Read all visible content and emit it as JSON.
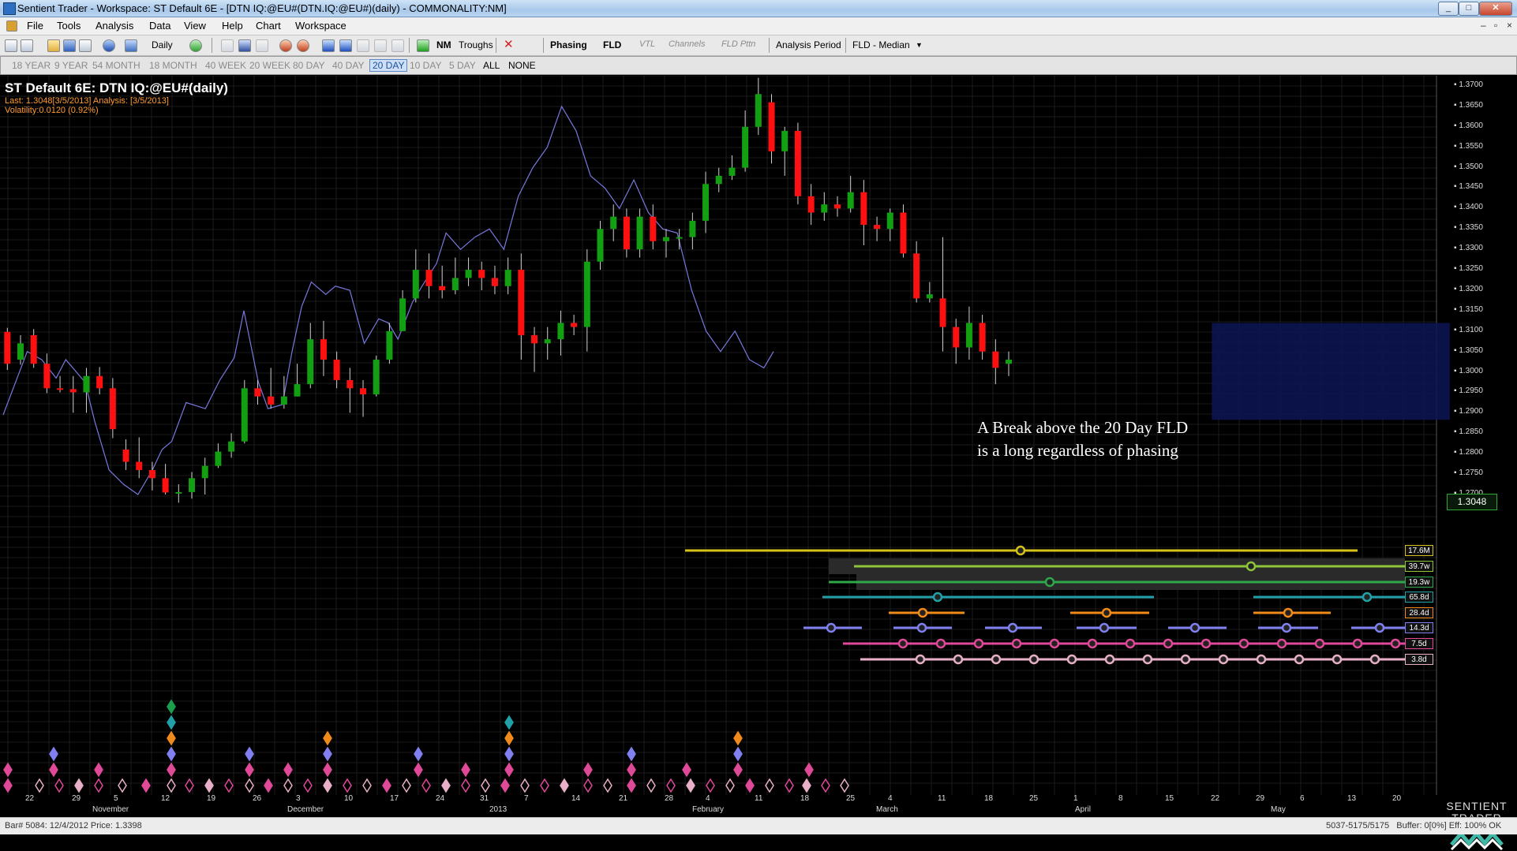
{
  "window": {
    "title": "Sentient Trader - Workspace: ST Default 6E - [DTN IQ:@EU#(DTN.IQ:@EU#)(daily) - COMMONALITY:NM]"
  },
  "menu": [
    "File",
    "Tools",
    "Analysis",
    "Data",
    "View",
    "Help",
    "Chart",
    "Workspace"
  ],
  "toolbar": {
    "interval": "Daily",
    "nm": "NM",
    "troughs": "Troughs",
    "phasing": "Phasing",
    "fld": "FLD",
    "vtl": "VTL",
    "channels": "Channels",
    "fld_pttn": "FLD Pttn",
    "analysis_period": "Analysis Period",
    "fld_median": "FLD - Median"
  },
  "periods": [
    "18 YEAR",
    "9 YEAR",
    "54 MONTH",
    "18 MONTH",
    "40 WEEK",
    "20 WEEK",
    "80 DAY",
    "40 DAY",
    "20 DAY",
    "10 DAY",
    "5 DAY",
    "ALL",
    "NONE"
  ],
  "active_period": "20 DAY",
  "chart": {
    "title": "ST Default 6E: DTN IQ:@EU#(daily)",
    "last_line": "Last: 1.3048[3/5/2013] Analysis: [3/5/2013]",
    "volatility_line": "Volatility:0.0120 (0.92%)",
    "last_price": "1.3048",
    "annotation_line1": "A Break above the 20 Day FLD",
    "annotation_line2": "is a long regardless of phasing",
    "price_ticks": [
      "1.3700",
      "1.3650",
      "1.3600",
      "1.3550",
      "1.3500",
      "1.3450",
      "1.3400",
      "1.3350",
      "1.3300",
      "1.3250",
      "1.3200",
      "1.3150",
      "1.3100",
      "1.3050",
      "1.3000",
      "1.2950",
      "1.2900",
      "1.2850",
      "1.2800",
      "1.2750",
      "1.2700"
    ],
    "date_ticks": [
      "22",
      "29",
      "5",
      "12",
      "19",
      "26",
      "3",
      "10",
      "17",
      "24",
      "31",
      "7",
      "14",
      "21",
      "28",
      "4",
      "11",
      "18",
      "25",
      "4",
      "11",
      "18",
      "25",
      "1",
      "8",
      "15",
      "22",
      "29",
      "6",
      "13",
      "20"
    ],
    "month_labels": [
      "November",
      "December",
      "2013",
      "February",
      "March",
      "April",
      "May"
    ],
    "cycles": [
      {
        "label": "17.6M",
        "color": "#d6c21a"
      },
      {
        "label": "39.7w",
        "color": "#8cc43a"
      },
      {
        "label": "19.3w",
        "color": "#2ea84a"
      },
      {
        "label": "65.8d",
        "color": "#22a0a8"
      },
      {
        "label": "28.4d",
        "color": "#f08a1a"
      },
      {
        "label": "14.3d",
        "color": "#8080f0"
      },
      {
        "label": "7.5d",
        "color": "#e04898"
      },
      {
        "label": "3.8d",
        "color": "#e8b0c8"
      }
    ]
  },
  "chart_data": {
    "type": "line",
    "title": "ST Default 6E: DTN IQ:@EU#(daily)",
    "ylim": [
      1.265,
      1.372
    ],
    "candles": [
      [
        1.3098,
        1.302,
        1.3108,
        1.3005
      ],
      [
        1.303,
        1.307,
        1.309,
        1.3018
      ],
      [
        1.309,
        1.302,
        1.3105,
        1.301
      ],
      [
        1.302,
        1.296,
        1.3045,
        1.2948
      ],
      [
        1.296,
        1.2958,
        1.299,
        1.295
      ],
      [
        1.2958,
        1.295,
        1.299,
        1.29
      ],
      [
        1.295,
        1.299,
        1.301,
        1.29
      ],
      [
        1.299,
        1.296,
        1.3012,
        1.2945
      ],
      [
        1.296,
        1.286,
        1.2985,
        1.2838
      ],
      [
        1.281,
        1.278,
        1.2835,
        1.276
      ],
      [
        1.278,
        1.276,
        1.284,
        1.274
      ],
      [
        1.276,
        1.274,
        1.278,
        1.271
      ],
      [
        1.274,
        1.2705,
        1.2775,
        1.27
      ],
      [
        1.2705,
        1.2706,
        1.2725,
        1.268
      ],
      [
        1.2706,
        1.274,
        1.2755,
        1.269
      ],
      [
        1.274,
        1.277,
        1.279,
        1.27
      ],
      [
        1.277,
        1.2805,
        1.2825,
        1.2765
      ],
      [
        1.2805,
        1.283,
        1.285,
        1.279
      ],
      [
        1.283,
        1.296,
        1.298,
        1.2825
      ],
      [
        1.296,
        1.294,
        1.298,
        1.292
      ],
      [
        1.294,
        1.292,
        1.301,
        1.291
      ],
      [
        1.292,
        1.294,
        1.299,
        1.291
      ],
      [
        1.294,
        1.297,
        1.302,
        1.294
      ],
      [
        1.297,
        1.308,
        1.312,
        1.296
      ],
      [
        1.308,
        1.303,
        1.3125,
        1.299
      ],
      [
        1.303,
        1.298,
        1.305,
        1.296
      ],
      [
        1.298,
        1.296,
        1.301,
        1.29
      ],
      [
        1.296,
        1.2945,
        1.298,
        1.289
      ],
      [
        1.2945,
        1.303,
        1.304,
        1.294
      ],
      [
        1.303,
        1.31,
        1.312,
        1.302
      ],
      [
        1.31,
        1.318,
        1.32,
        1.31
      ],
      [
        1.318,
        1.325,
        1.33,
        1.317
      ],
      [
        1.325,
        1.321,
        1.329,
        1.318
      ],
      [
        1.321,
        1.32,
        1.326,
        1.318
      ],
      [
        1.32,
        1.323,
        1.328,
        1.319
      ],
      [
        1.323,
        1.325,
        1.328,
        1.321
      ],
      [
        1.325,
        1.323,
        1.327,
        1.32
      ],
      [
        1.323,
        1.321,
        1.326,
        1.319
      ],
      [
        1.321,
        1.325,
        1.328,
        1.319
      ],
      [
        1.325,
        1.309,
        1.329,
        1.303
      ],
      [
        1.309,
        1.307,
        1.311,
        1.3
      ],
      [
        1.307,
        1.308,
        1.311,
        1.303
      ],
      [
        1.308,
        1.312,
        1.315,
        1.304
      ],
      [
        1.312,
        1.311,
        1.314,
        1.309
      ],
      [
        1.311,
        1.327,
        1.33,
        1.305
      ],
      [
        1.327,
        1.335,
        1.337,
        1.325
      ],
      [
        1.335,
        1.338,
        1.341,
        1.332
      ],
      [
        1.338,
        1.33,
        1.34,
        1.328
      ],
      [
        1.33,
        1.338,
        1.34,
        1.328
      ],
      [
        1.338,
        1.332,
        1.341,
        1.33
      ],
      [
        1.332,
        1.333,
        1.335,
        1.328
      ],
      [
        1.333,
        1.333,
        1.335,
        1.33
      ],
      [
        1.333,
        1.337,
        1.339,
        1.33
      ],
      [
        1.337,
        1.346,
        1.349,
        1.334
      ],
      [
        1.346,
        1.348,
        1.35,
        1.344
      ],
      [
        1.348,
        1.35,
        1.353,
        1.347
      ],
      [
        1.35,
        1.36,
        1.364,
        1.349
      ],
      [
        1.36,
        1.368,
        1.372,
        1.358
      ],
      [
        1.366,
        1.354,
        1.368,
        1.351
      ],
      [
        1.354,
        1.359,
        1.36,
        1.348
      ],
      [
        1.359,
        1.343,
        1.361,
        1.341
      ],
      [
        1.343,
        1.339,
        1.346,
        1.336
      ],
      [
        1.339,
        1.341,
        1.344,
        1.337
      ],
      [
        1.341,
        1.34,
        1.343,
        1.338
      ],
      [
        1.34,
        1.344,
        1.348,
        1.339
      ],
      [
        1.344,
        1.336,
        1.347,
        1.331
      ],
      [
        1.336,
        1.335,
        1.338,
        1.332
      ],
      [
        1.335,
        1.339,
        1.34,
        1.332
      ],
      [
        1.339,
        1.329,
        1.341,
        1.328
      ],
      [
        1.329,
        1.318,
        1.332,
        1.317
      ],
      [
        1.318,
        1.319,
        1.322,
        1.317
      ],
      [
        1.318,
        1.311,
        1.333,
        1.305
      ],
      [
        1.311,
        1.306,
        1.313,
        1.302
      ],
      [
        1.306,
        1.312,
        1.316,
        1.303
      ],
      [
        1.312,
        1.305,
        1.314,
        1.303
      ],
      [
        1.305,
        1.301,
        1.308,
        1.297
      ],
      [
        1.302,
        1.303,
        1.305,
        1.299
      ]
    ],
    "fld_line": [
      [
        0,
        1.2895
      ],
      [
        5,
        1.305
      ],
      [
        8,
        1.303
      ],
      [
        11,
        1.2985
      ],
      [
        13,
        1.303
      ],
      [
        17,
        1.2975
      ],
      [
        19,
        1.288
      ],
      [
        22,
        1.276
      ],
      [
        25,
        1.2725
      ],
      [
        28,
        1.27
      ],
      [
        31,
        1.276
      ],
      [
        33,
        1.281
      ],
      [
        35,
        1.283
      ],
      [
        38,
        1.2925
      ],
      [
        42,
        1.291
      ],
      [
        45,
        1.298
      ],
      [
        48,
        1.3035
      ],
      [
        50,
        1.315
      ],
      [
        53,
        1.2975
      ],
      [
        55,
        1.291
      ],
      [
        58,
        1.292
      ],
      [
        60,
        1.305
      ],
      [
        62,
        1.316
      ],
      [
        64,
        1.322
      ],
      [
        67,
        1.319
      ],
      [
        69,
        1.321
      ],
      [
        72,
        1.32
      ],
      [
        75,
        1.307
      ],
      [
        78,
        1.313
      ],
      [
        80,
        1.312
      ],
      [
        82,
        1.308
      ],
      [
        85,
        1.317
      ],
      [
        87,
        1.321
      ],
      [
        90,
        1.3265
      ],
      [
        92,
        1.334
      ],
      [
        95,
        1.33
      ],
      [
        98,
        1.333
      ],
      [
        101,
        1.335
      ],
      [
        104,
        1.33
      ],
      [
        107,
        1.343
      ],
      [
        110,
        1.35
      ],
      [
        113,
        1.355
      ],
      [
        116,
        1.365
      ],
      [
        119,
        1.359
      ],
      [
        122,
        1.348
      ],
      [
        125,
        1.345
      ],
      [
        128,
        1.34
      ],
      [
        131,
        1.347
      ],
      [
        134,
        1.339
      ],
      [
        137,
        1.335
      ],
      [
        140,
        1.334
      ],
      [
        143,
        1.32
      ],
      [
        146,
        1.31
      ],
      [
        149,
        1.305
      ],
      [
        152,
        1.31
      ],
      [
        155,
        1.303
      ],
      [
        158,
        1.301
      ],
      [
        160,
        1.305
      ]
    ],
    "highlight_box": {
      "x_from": 142,
      "x_to": 170,
      "y_from": 1.2883,
      "y_to": 1.312
    }
  }
}
